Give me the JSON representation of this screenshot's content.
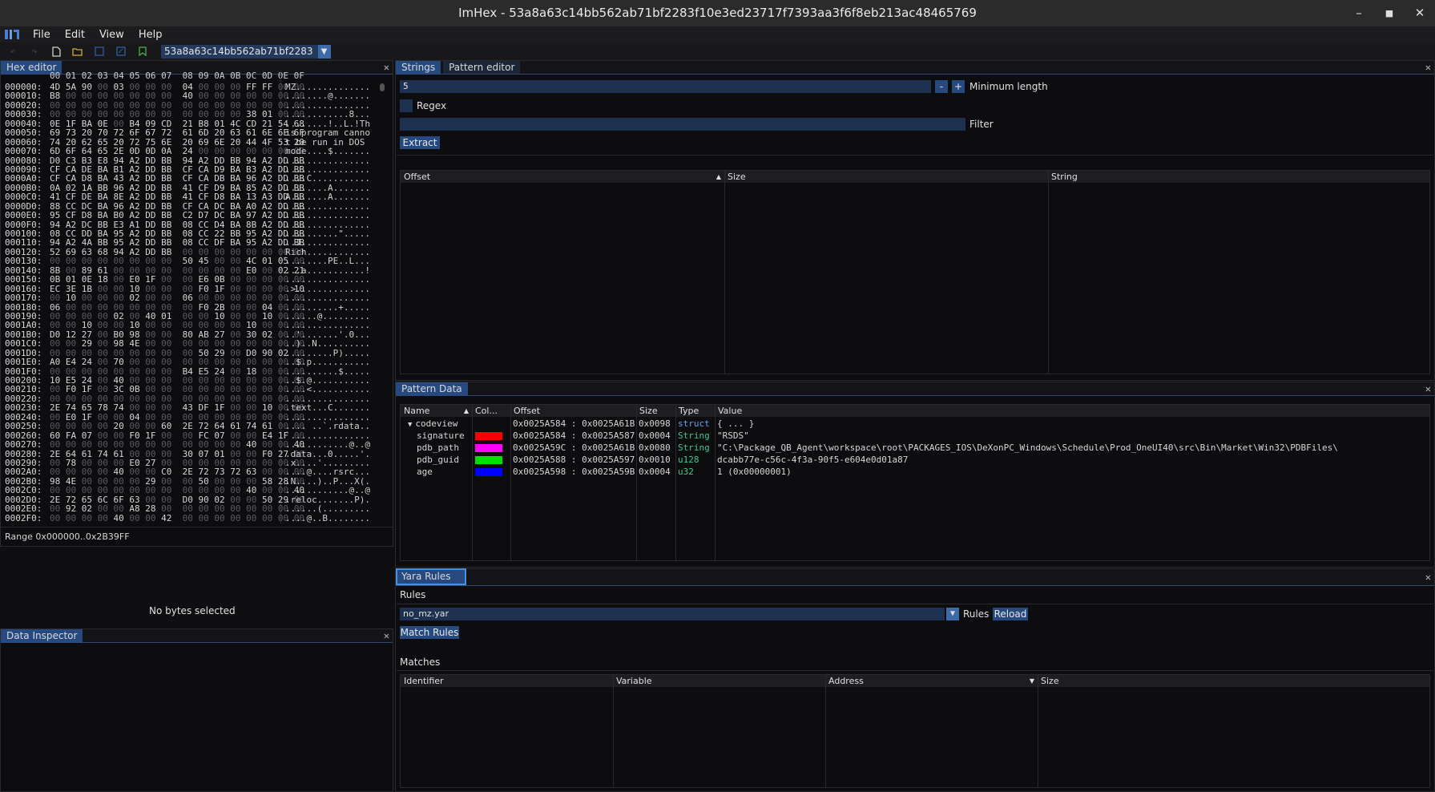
{
  "window": {
    "title": "ImHex - 53a8a63c14bb562ab71bf2283f10e3ed23717f7393aa3f6f8eb213ac48465769",
    "minimize": "–",
    "maximize": "■",
    "close": "✕"
  },
  "menu": [
    "File",
    "Edit",
    "View",
    "Help"
  ],
  "toolbar": {
    "provider": "53a8a63c14bb562ab71bf2283",
    "provider_arrow": "▼",
    "icons": [
      "undo-icon",
      "redo-icon",
      "new-file-icon",
      "open-file-icon",
      "save-icon",
      "save-as-icon",
      "bookmark-icon"
    ]
  },
  "hex_editor": {
    "tab": "Hex editor",
    "close": "✕",
    "columns": "00 01 02 03 04 05 06 07  08 09 0A 0B 0C 0D 0E 0F",
    "rows": [
      {
        "o": "000000:",
        "b": "4D 5A 90 00 03 00 00 00  04 00 00 00 FF FF 00 00",
        "a": "MZ.............."
      },
      {
        "o": "000010:",
        "b": "B8 00 00 00 00 00 00 00  40 00 00 00 00 00 00 00",
        "a": "........@......."
      },
      {
        "o": "000020:",
        "b": "00 00 00 00 00 00 00 00  00 00 00 00 00 00 00 00",
        "a": "................"
      },
      {
        "o": "000030:",
        "b": "00 00 00 00 00 00 00 00  00 00 00 00 38 01 00 00",
        "a": "............8..."
      },
      {
        "o": "000040:",
        "b": "0E 1F BA 0E 00 B4 09 CD  21 B8 01 4C CD 21 54 68",
        "a": "........!..L.!Th"
      },
      {
        "o": "000050:",
        "b": "69 73 20 70 72 6F 67 72  61 6D 20 63 61 6E 6E 6F",
        "a": "is program canno"
      },
      {
        "o": "000060:",
        "b": "74 20 62 65 20 72 75 6E  20 69 6E 20 44 4F 53 20",
        "a": "t be run in DOS "
      },
      {
        "o": "000070:",
        "b": "6D 6F 64 65 2E 0D 0D 0A  24 00 00 00 00 00 00 00",
        "a": "mode....$......."
      },
      {
        "o": "000080:",
        "b": "D0 C3 B3 E8 94 A2 DD BB  94 A2 DD BB 94 A2 DD BB",
        "a": "................"
      },
      {
        "o": "000090:",
        "b": "CF CA DE BA B1 A2 DD BB  CF CA D9 BA B3 A2 DD BB",
        "a": "................"
      },
      {
        "o": "0000A0:",
        "b": "CF CA D8 BA 43 A2 DD BB  CF CA DB BA 96 A2 DD BB",
        "a": "....C..........."
      },
      {
        "o": "0000B0:",
        "b": "0A 02 1A BB 96 A2 DD BB  41 CF D9 BA 85 A2 DD BB",
        "a": "........A......."
      },
      {
        "o": "0000C0:",
        "b": "41 CF DE BA 8E A2 DD BB  41 CF D8 BA 13 A3 DD BB",
        "a": "A.......A......."
      },
      {
        "o": "0000D0:",
        "b": "88 CC DC BA 96 A2 DD BB  CF CA DC BA A0 A2 DD BB",
        "a": "................"
      },
      {
        "o": "0000E0:",
        "b": "95 CF D8 BA B0 A2 DD BB  C2 D7 DC BA 97 A2 DD BB",
        "a": "................"
      },
      {
        "o": "0000F0:",
        "b": "94 A2 DC BB E3 A1 DD BB  08 CC D4 BA 8B A2 DD BB",
        "a": "................"
      },
      {
        "o": "000100:",
        "b": "08 CC DD BA 95 A2 DD BB  08 CC 22 BB 95 A2 DD BB",
        "a": "..........\"....."
      },
      {
        "o": "000110:",
        "b": "94 A2 4A BB 95 A2 DD BB  08 CC DF BA 95 A2 DD BB",
        "a": "..J............."
      },
      {
        "o": "000120:",
        "b": "52 69 63 68 94 A2 DD BB  00 00 00 00 00 00 00 00",
        "a": "Rich............"
      },
      {
        "o": "000130:",
        "b": "00 00 00 00 00 00 00 00  50 45 00 00 4C 01 05 00",
        "a": "........PE..L..."
      },
      {
        "o": "000140:",
        "b": "8B 00 89 61 00 00 00 00  00 00 00 00 E0 00 02 21",
        "a": "...a...........!"
      },
      {
        "o": "000150:",
        "b": "0B 01 0E 18 00 E0 1F 00  00 E6 0B 00 00 00 00 00",
        "a": "................"
      },
      {
        "o": "000160:",
        "b": "EC 3E 1B 00 00 10 00 00  00 F0 1F 00 00 00 00 10",
        "a": ".>.............."
      },
      {
        "o": "000170:",
        "b": "00 10 00 00 00 02 00 00  06 00 00 00 00 00 00 00",
        "a": "................"
      },
      {
        "o": "000180:",
        "b": "06 00 00 00 00 00 00 00  00 F0 2B 00 00 04 00 00",
        "a": "..........+....."
      },
      {
        "o": "000190:",
        "b": "00 00 00 00 02 00 40 01  00 00 10 00 00 10 00 00",
        "a": "......@........."
      },
      {
        "o": "0001A0:",
        "b": "00 00 10 00 00 10 00 00  00 00 00 00 10 00 00 00",
        "a": "................"
      },
      {
        "o": "0001B0:",
        "b": "D0 12 27 00 B0 98 00 00  80 AB 27 00 30 02 00 00",
        "a": "..'.......'.0..."
      },
      {
        "o": "0001C0:",
        "b": "00 00 29 00 98 4E 00 00  00 00 00 00 00 00 00 00",
        "a": "..)..N.........."
      },
      {
        "o": "0001D0:",
        "b": "00 00 00 00 00 00 00 00  00 50 29 00 D0 90 02 00",
        "a": ".........P)....."
      },
      {
        "o": "0001E0:",
        "b": "A0 E4 24 00 70 00 00 00  00 00 00 00 00 00 00 00",
        "a": "..$.p..........."
      },
      {
        "o": "0001F0:",
        "b": "00 00 00 00 00 00 00 00  B4 E5 24 00 18 00 00 00",
        "a": "..........$....."
      },
      {
        "o": "000200:",
        "b": "10 E5 24 00 40 00 00 00  00 00 00 00 00 00 00 00",
        "a": "..$.@..........."
      },
      {
        "o": "000210:",
        "b": "00 F0 1F 00 3C 0B 00 00  00 00 00 00 00 00 00 00",
        "a": "....<..........."
      },
      {
        "o": "000220:",
        "b": "00 00 00 00 00 00 00 00  00 00 00 00 00 00 00 00",
        "a": "................"
      },
      {
        "o": "000230:",
        "b": "2E 74 65 78 74 00 00 00  43 DF 1F 00 00 10 00 00",
        "a": ".text...C......."
      },
      {
        "o": "000240:",
        "b": "00 E0 1F 00 00 04 00 00  00 00 00 00 00 00 00 00",
        "a": "................"
      },
      {
        "o": "000250:",
        "b": "00 00 00 00 20 00 00 60  2E 72 64 61 74 61 00 00",
        "a": ".... ..`.rdata.."
      },
      {
        "o": "000260:",
        "b": "60 FA 07 00 00 F0 1F 00  00 FC 07 00 00 E4 1F 00",
        "a": "`..............."
      },
      {
        "o": "000270:",
        "b": "00 00 00 00 00 00 00 00  00 00 00 00 40 00 00 40",
        "a": "............@..@"
      },
      {
        "o": "000280:",
        "b": "2E 64 61 74 61 00 00 00  30 07 01 00 00 F0 27 00",
        "a": ".data...0.....'."
      },
      {
        "o": "000290:",
        "b": "00 78 00 00 00 E0 27 00  00 00 00 00 00 00 00 00",
        "a": ".x....'........."
      },
      {
        "o": "0002A0:",
        "b": "00 00 00 00 40 00 00 C0  2E 72 73 72 63 00 00 00",
        "a": "....@....rsrc..."
      },
      {
        "o": "0002B0:",
        "b": "98 4E 00 00 00 00 29 00  00 50 00 00 00 58 28 00",
        "a": ".N....)..P...X(."
      },
      {
        "o": "0002C0:",
        "b": "00 00 00 00 00 00 00 00  00 00 00 00 40 00 00 40",
        "a": "............@..@"
      },
      {
        "o": "0002D0:",
        "b": "2E 72 65 6C 6F 63 00 00  D0 90 02 00 00 50 29 00",
        "a": ".reloc.......P)."
      },
      {
        "o": "0002E0:",
        "b": "00 92 02 00 00 A8 28 00  00 00 00 00 00 00 00 00",
        "a": "......(........."
      },
      {
        "o": "0002F0:",
        "b": "00 00 00 00 40 00 00 42  00 00 00 00 00 00 00 00",
        "a": "....@..B........"
      }
    ],
    "range": "Range 0x000000..0x2B39FF"
  },
  "data_inspector": {
    "tab": "Data Inspector",
    "close": "✕",
    "empty": "No bytes selected"
  },
  "strings": {
    "tab_strings": "Strings",
    "tab_pattern": "Pattern editor",
    "close": "✕",
    "min_length_value": "5",
    "minus": "-",
    "plus": "+",
    "min_length_label": "Minimum length",
    "regex_label": "Regex",
    "filter_label": "Filter",
    "extract": "Extract",
    "columns": [
      "Offset",
      "Size",
      "String"
    ],
    "sort_icon": "▲"
  },
  "pattern_data": {
    "tab": "Pattern Data",
    "close": "✕",
    "columns": [
      "Name",
      "Col...",
      "Offset",
      "Size",
      "Type",
      "Value"
    ],
    "sort_icon": "▲",
    "rows": [
      {
        "name": "codeview",
        "offset": "0x0025A584 : 0x0025A61B",
        "size": "0x0098",
        "type": "struct",
        "value": "{ ... }",
        "color": "",
        "expander": "▼"
      },
      {
        "name": "signature",
        "offset": "0x0025A584 : 0x0025A587",
        "size": "0x0004",
        "type": "String",
        "value": "\"RSDS\"",
        "color": "#ff0000",
        "expander": ""
      },
      {
        "name": "pdb_path",
        "offset": "0x0025A59C : 0x0025A61B",
        "size": "0x0080",
        "type": "String",
        "value": "\"C:\\Package_QB_Agent\\workspace\\root\\PACKAGES_IOS\\DeXonPC_Windows\\Schedule\\Prod_OneUI40\\src\\Bin\\Market\\Win32\\PDBFiles\\",
        "color": "#ff00ff",
        "expander": ""
      },
      {
        "name": "pdb_guid",
        "offset": "0x0025A588 : 0x0025A597",
        "size": "0x0010",
        "type": "u128",
        "value": "dcabb77e-c56c-4f3a-90f5-e604e0d01a87",
        "color": "#00e000",
        "expander": ""
      },
      {
        "name": "age",
        "offset": "0x0025A598 : 0x0025A59B",
        "size": "0x0004",
        "type": "u32",
        "value": "1 (0x00000001)",
        "color": "#0000ff",
        "expander": ""
      }
    ]
  },
  "yara": {
    "tab": "Yara Rules",
    "close": "✕",
    "rules_label": "Rules",
    "selected_rule": "no_mz.yar",
    "combo_arrow": "▼",
    "rules_combo_label": "Rules",
    "reload": "Reload",
    "match": "Match Rules",
    "matches_label": "Matches",
    "columns": [
      "Identifier",
      "Variable",
      "Address",
      "Size"
    ],
    "sort_icon": "▼"
  },
  "colors": {
    "accent": "#264a80",
    "tab_inactive": "#1b2638",
    "input_bg": "#1e3150",
    "titlebar": "#2b2b2b"
  }
}
